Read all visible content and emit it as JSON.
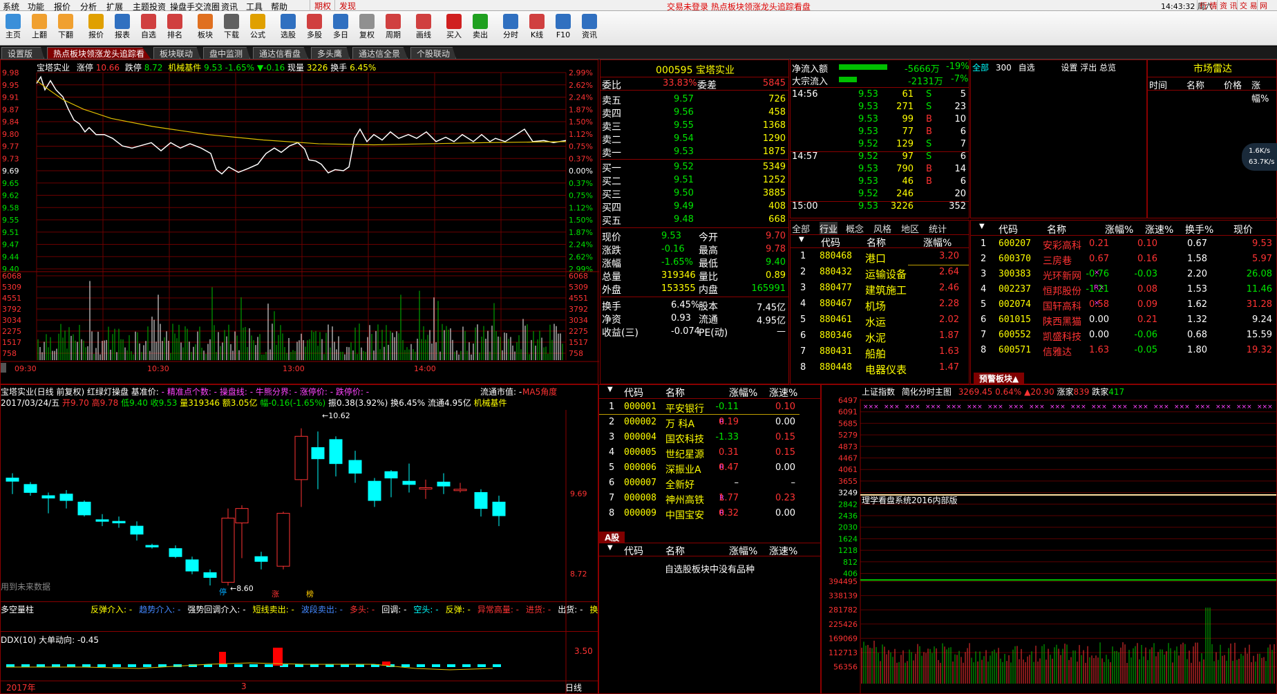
{
  "menu": {
    "items": [
      "系统",
      "功能",
      "报价",
      "分析",
      "扩展",
      "主题投资",
      "操盘手交流圈",
      "资讯",
      "工具",
      "帮助"
    ],
    "tabs_right": [
      "期权",
      "发现"
    ],
    "status": "交易未登录   热点板块领涨龙头追踪看盘",
    "time": "14:43:32 周六",
    "right_buttons": [
      "行 情",
      "资 讯",
      "交 易",
      "网 站"
    ]
  },
  "toolbar": {
    "buttons": [
      {
        "label": "主页",
        "color": "#3a8fd9"
      },
      {
        "label": "上翻",
        "color": "#f0a030"
      },
      {
        "label": "下翻",
        "color": "#f0a030"
      },
      {
        "label": "报价",
        "color": "#e0a000"
      },
      {
        "label": "报表",
        "color": "#3070c0"
      },
      {
        "label": "自选",
        "color": "#d04040"
      },
      {
        "label": "排名",
        "color": "#d04040"
      },
      {
        "label": "板块",
        "color": "#e07020"
      },
      {
        "label": "下载",
        "color": "#606060"
      },
      {
        "label": "公式",
        "color": "#e0a000"
      },
      {
        "label": "选股",
        "color": "#3070c0"
      },
      {
        "label": "多股",
        "color": "#d04040"
      },
      {
        "label": "多日",
        "color": "#3070c0"
      },
      {
        "label": "复权",
        "color": "#909090"
      },
      {
        "label": "周期",
        "color": "#d04040"
      },
      {
        "label": "画线",
        "color": "#d04040"
      },
      {
        "label": "买入",
        "color": "#d02020"
      },
      {
        "label": "卖出",
        "color": "#20a020"
      },
      {
        "label": "分时",
        "color": "#3070c0"
      },
      {
        "label": "K线",
        "color": "#d04040"
      },
      {
        "label": "F10",
        "color": "#3070c0"
      },
      {
        "label": "资讯",
        "color": "#3070c0"
      }
    ]
  },
  "tabs": [
    "设置版面",
    "热点板块领涨龙头追踪看盘",
    "板块联动",
    "盘中监测",
    "通达信看盘",
    "多头鹰",
    "通达信全景",
    "个股联动"
  ],
  "intraday": {
    "header": {
      "name": "宝塔实业",
      "zt_label": "涨停",
      "zt": "10.66",
      "dt_label": "跌停",
      "dt": "8.72",
      "sector": "机械基件",
      "price": "9.53",
      "pct": "-1.65%",
      "chg": "▼-0.16",
      "vol_label": "现量",
      "vol": "3226",
      "hs_label": "换手",
      "hs": "6.45%"
    },
    "left_ticks": [
      "9.98",
      "9.95",
      "9.91",
      "9.87",
      "9.84",
      "9.80",
      "9.77",
      "9.73",
      "9.69",
      "9.65",
      "9.62",
      "9.58",
      "9.55",
      "9.51",
      "9.47",
      "9.44",
      "9.40"
    ],
    "right_ticks": [
      "2.99%",
      "2.62%",
      "2.24%",
      "1.87%",
      "1.50%",
      "1.12%",
      "0.75%",
      "0.37%",
      "0.00%",
      "0.37%",
      "0.75%",
      "1.12%",
      "1.50%",
      "1.87%",
      "2.24%",
      "2.62%",
      "2.99%"
    ],
    "vol_ticks": [
      "6068",
      "5309",
      "4551",
      "3792",
      "3034",
      "2275",
      "1517",
      "758"
    ],
    "time_ticks": [
      "09:30",
      "10:30",
      "13:00",
      "14:00"
    ]
  },
  "quote": {
    "code": "000595",
    "name": "宝塔实业",
    "wb_label": "委比",
    "wb": "33.83%",
    "wc_label": "委差",
    "wc": "5845",
    "asks": [
      {
        "l": "卖五",
        "p": "9.57",
        "v": "726"
      },
      {
        "l": "卖四",
        "p": "9.56",
        "v": "458"
      },
      {
        "l": "卖三",
        "p": "9.55",
        "v": "1368"
      },
      {
        "l": "卖二",
        "p": "9.54",
        "v": "1290"
      },
      {
        "l": "卖一",
        "p": "9.53",
        "v": "1875"
      }
    ],
    "bids": [
      {
        "l": "买一",
        "p": "9.52",
        "v": "5349"
      },
      {
        "l": "买二",
        "p": "9.51",
        "v": "1252"
      },
      {
        "l": "买三",
        "p": "9.50",
        "v": "3885"
      },
      {
        "l": "买四",
        "p": "9.49",
        "v": "408"
      },
      {
        "l": "买五",
        "p": "9.48",
        "v": "668"
      }
    ],
    "stats": [
      {
        "a": "现价",
        "b": "9.53",
        "c": "今开",
        "d": "9.70"
      },
      {
        "a": "涨跌",
        "b": "-0.16",
        "c": "最高",
        "d": "9.78"
      },
      {
        "a": "涨幅",
        "b": "-1.65%",
        "c": "最低",
        "d": "9.40"
      },
      {
        "a": "总量",
        "b": "319346",
        "c": "量比",
        "d": "0.89"
      },
      {
        "a": "外盘",
        "b": "153355",
        "c": "内盘",
        "d": "165991"
      }
    ],
    "stats2": [
      {
        "a": "换手",
        "b": "6.45%",
        "c": "股本",
        "d": "7.45亿"
      },
      {
        "a": "净资",
        "b": "0.93",
        "c": "流通",
        "d": "4.95亿"
      },
      {
        "a": "收益(三)",
        "b": "-0.074",
        "c": "PE(动)",
        "d": "—"
      }
    ]
  },
  "flow": {
    "net_label": "净流入额",
    "net": "-5666万",
    "net_pct": "-19%",
    "big_label": "大宗流入",
    "big": "-2131万",
    "big_pct": "-7%",
    "ticks": [
      {
        "t": "14:56",
        "p": "9.53",
        "v": "61",
        "s": "S",
        "n": "5"
      },
      {
        "t": "",
        "p": "9.53",
        "v": "271",
        "s": "S",
        "n": "23"
      },
      {
        "t": "",
        "p": "9.53",
        "v": "99",
        "s": "B",
        "n": "10"
      },
      {
        "t": "",
        "p": "9.53",
        "v": "77",
        "s": "B",
        "n": "6"
      },
      {
        "t": "",
        "p": "9.52",
        "v": "129",
        "s": "S",
        "n": "7"
      },
      {
        "t": "14:57",
        "p": "9.52",
        "v": "97",
        "s": "S",
        "n": "6"
      },
      {
        "t": "",
        "p": "9.53",
        "v": "790",
        "s": "B",
        "n": "14"
      },
      {
        "t": "",
        "p": "9.53",
        "v": "46",
        "s": "B",
        "n": "6"
      },
      {
        "t": "",
        "p": "9.52",
        "v": "246",
        "s": "",
        "n": "20"
      },
      {
        "t": "15:00",
        "p": "9.53",
        "v": "3226",
        "s": "",
        "n": "352"
      }
    ]
  },
  "watch": {
    "tabs": [
      "全部",
      "300",
      "自选"
    ],
    "actions": "设置 浮出 总览"
  },
  "radar": {
    "title": "市场雷达",
    "cols": [
      "时间",
      "名称",
      "价格",
      "涨幅%"
    ],
    "speed1": "1.6K/s",
    "speed2": "63.7K/s"
  },
  "sectors": {
    "tabs": [
      "全部",
      "行业",
      "概念",
      "风格",
      "地区",
      "统计"
    ],
    "cols": [
      "代码",
      "名称",
      "涨幅%"
    ],
    "rows": [
      {
        "i": "1",
        "c": "880468",
        "n": "港口",
        "p": "3.20"
      },
      {
        "i": "2",
        "c": "880432",
        "n": "运输设备",
        "p": "2.64"
      },
      {
        "i": "3",
        "c": "880477",
        "n": "建筑施工",
        "p": "2.46"
      },
      {
        "i": "4",
        "c": "880467",
        "n": "机场",
        "p": "2.28"
      },
      {
        "i": "5",
        "c": "880461",
        "n": "水运",
        "p": "2.02"
      },
      {
        "i": "6",
        "c": "880346",
        "n": "水泥",
        "p": "1.87"
      },
      {
        "i": "7",
        "c": "880431",
        "n": "船舶",
        "p": "1.63"
      },
      {
        "i": "8",
        "c": "880448",
        "n": "电器仪表",
        "p": "1.47"
      }
    ]
  },
  "leaders": {
    "cols": [
      "代码",
      "名称",
      "涨幅%",
      "涨速%",
      "换手%",
      "现价"
    ],
    "rows": [
      {
        "i": "1",
        "c": "600207",
        "n": "安彩高科",
        "x": "",
        "p": "0.21",
        "s": "0.10",
        "h": "0.67",
        "v": "9.53",
        "pc": "red",
        "sc": "red",
        "vc": "red"
      },
      {
        "i": "2",
        "c": "600370",
        "n": "三房巷",
        "x": "",
        "p": "0.67",
        "s": "0.16",
        "h": "1.58",
        "v": "5.97",
        "pc": "red",
        "sc": "red",
        "vc": "red"
      },
      {
        "i": "3",
        "c": "300383",
        "n": "光环新网",
        "x": "×",
        "p": "-0.76",
        "s": "-0.03",
        "h": "2.20",
        "v": "26.08",
        "pc": "green",
        "sc": "green",
        "vc": "green"
      },
      {
        "i": "4",
        "c": "002237",
        "n": "恒邦股份",
        "x": "R×",
        "p": "-1.21",
        "s": "0.08",
        "h": "1.53",
        "v": "11.46",
        "pc": "green",
        "sc": "red",
        "vc": "green"
      },
      {
        "i": "5",
        "c": "002074",
        "n": "国轩高科",
        "x": "×",
        "p": "0.58",
        "s": "0.09",
        "h": "1.62",
        "v": "31.28",
        "pc": "red",
        "sc": "red",
        "vc": "red"
      },
      {
        "i": "6",
        "c": "601015",
        "n": "陕西黑猫",
        "x": "",
        "p": "0.00",
        "s": "0.21",
        "h": "1.32",
        "v": "9.24",
        "pc": "white",
        "sc": "red",
        "vc": "white"
      },
      {
        "i": "7",
        "c": "600552",
        "n": "凯盛科技",
        "x": "",
        "p": "0.00",
        "s": "-0.06",
        "h": "0.68",
        "v": "15.59",
        "pc": "white",
        "sc": "green",
        "vc": "white"
      },
      {
        "i": "8",
        "c": "600571",
        "n": "信雅达",
        "x": "",
        "p": "1.63",
        "s": "-0.05",
        "h": "1.80",
        "v": "19.32",
        "pc": "red",
        "sc": "green",
        "vc": "red"
      }
    ],
    "warn_tab": "预警板块▲"
  },
  "kline": {
    "line1": [
      {
        "t": "宝塔实业(日线 前复权) 红绿灯操盘  基准价: ",
        "c": "white"
      },
      {
        "t": "- 精准点个数: -",
        "c": "magenta"
      },
      {
        "t": "  操盘线: - 牛熊分界: -",
        "c": "magenta"
      },
      {
        "t": "  涨停价: - 跌停价: -",
        "c": "magenta"
      }
    ],
    "line1_right": "流通市值: -",
    "line1_right2": "MA5角度",
    "line2": [
      {
        "t": "2017/03/24/五 ",
        "c": "white"
      },
      {
        "t": "开9.70 高9.78 ",
        "c": "red"
      },
      {
        "t": "低9.40 收9.53 ",
        "c": "green"
      },
      {
        "t": "量319346 额3.05亿 ",
        "c": "yellow"
      },
      {
        "t": "幅-0.16(-1.65%) ",
        "c": "green"
      },
      {
        "t": "振0.38(3.92%) 换6.45% 流通4.95亿 ",
        "c": "white"
      },
      {
        "t": "机械基件",
        "c": "yellow"
      }
    ],
    "high_label": "10.62",
    "low_label": "8.60",
    "right_ticks": [
      "9.69",
      "8.72"
    ],
    "future_note": "用到未来数据",
    "markers": [
      "停",
      "涨",
      "榜"
    ],
    "signal_title": "多空量柱",
    "signals": [
      {
        "t": "反弹介入: -",
        "c": "yellow"
      },
      {
        "t": "趋势介入: -",
        "c": "blue"
      },
      {
        "t": "强势回调介入: -",
        "c": "white"
      },
      {
        "t": "短线卖出: -",
        "c": "yellow"
      },
      {
        "t": "波段卖出: -",
        "c": "blue"
      },
      {
        "t": "多头: -",
        "c": "red"
      },
      {
        "t": "回调: -",
        "c": "white"
      },
      {
        "t": "空头: -",
        "c": "cyan"
      },
      {
        "t": "反弹: -",
        "c": "yellow"
      },
      {
        "t": "异常高量: -",
        "c": "red"
      },
      {
        "t": "进货: -",
        "c": "red"
      },
      {
        "t": "出货: -",
        "c": "white"
      },
      {
        "t": "换",
        "c": "yellow"
      }
    ],
    "ddx_title": "DDX(10)  大单动向: -0.45",
    "ddx_tick": "3.50",
    "year": "2017年",
    "month": "3",
    "period": "日线"
  },
  "mid": {
    "cols": [
      "代码",
      "名称",
      "涨幅%",
      "涨速%"
    ],
    "rows": [
      {
        "i": "1",
        "c": "000001",
        "n": "平安银行",
        "x": "",
        "p": "-0.11",
        "s": "0.10",
        "pc": "green",
        "sc": "red",
        "hl": true
      },
      {
        "i": "2",
        "c": "000002",
        "n": "万 科A",
        "x": "R",
        "p": "0.19",
        "s": "0.00",
        "pc": "red",
        "sc": "white"
      },
      {
        "i": "3",
        "c": "000004",
        "n": "国农科技",
        "x": "",
        "p": "-1.33",
        "s": "0.15",
        "pc": "green",
        "sc": "red"
      },
      {
        "i": "4",
        "c": "000005",
        "n": "世纪星源",
        "x": "",
        "p": "0.31",
        "s": "0.15",
        "pc": "red",
        "sc": "red"
      },
      {
        "i": "5",
        "c": "000006",
        "n": "深振业A",
        "x": "R",
        "p": "0.47",
        "s": "0.00",
        "pc": "red",
        "sc": "white"
      },
      {
        "i": "6",
        "c": "000007",
        "n": "全新好",
        "x": "",
        "p": "–",
        "s": "–",
        "pc": "white",
        "sc": "white"
      },
      {
        "i": "7",
        "c": "000008",
        "n": "神州高铁",
        "x": "R",
        "p": "1.77",
        "s": "0.23",
        "pc": "red",
        "sc": "red"
      },
      {
        "i": "8",
        "c": "000009",
        "n": "中国宝安",
        "x": "R",
        "p": "0.32",
        "s": "0.00",
        "pc": "red",
        "sc": "white"
      }
    ],
    "tab": "A股",
    "empty": "自选股板块中没有品种"
  },
  "index": {
    "title": "上证指数",
    "sub": "简化分时主图",
    "val": "3269.45",
    "pct": "0.64%",
    "chg": "▲20.90",
    "up_label": "涨家",
    "up": "839",
    "dn_label": "跌家",
    "dn": "417",
    "ticks": [
      "6497",
      "6091",
      "5685",
      "5279",
      "4873",
      "4467",
      "4061",
      "3655",
      "3249",
      "2842",
      "2436",
      "2030",
      "1624",
      "1218",
      "812",
      "406"
    ],
    "vol_ticks": [
      "394495",
      "338139",
      "281782",
      "225426",
      "169069",
      "112713",
      "56356"
    ],
    "note": "理学看盘系统2016内部版"
  }
}
